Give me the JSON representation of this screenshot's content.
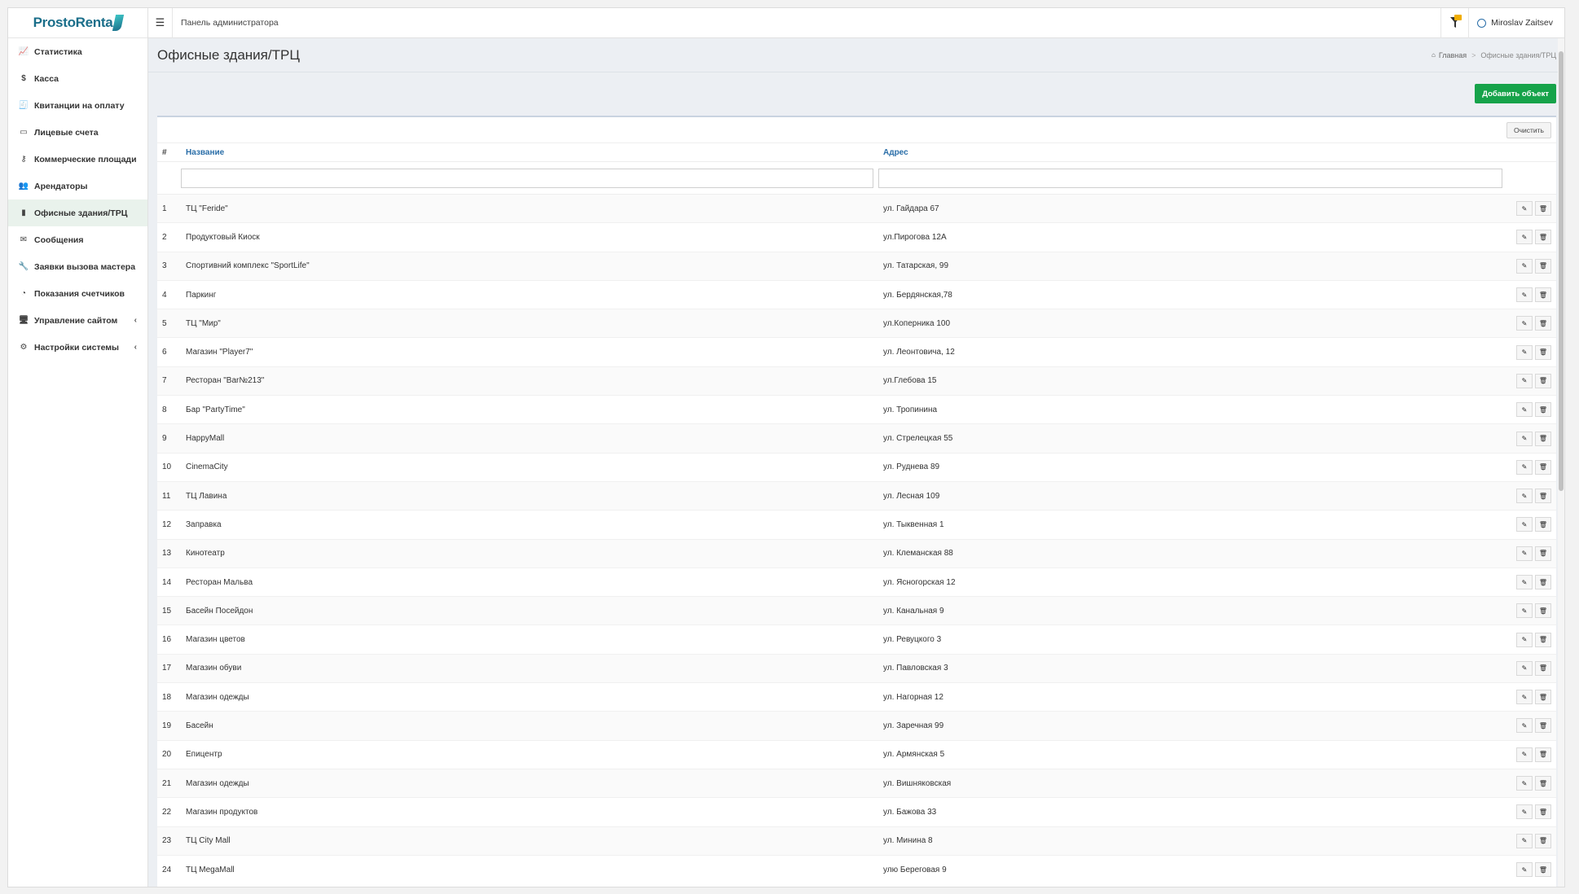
{
  "brand": {
    "name": "ProstoRenta"
  },
  "header": {
    "title": "Панель администратора",
    "user": "Miroslav Zaitsev"
  },
  "sidebar": {
    "items": [
      {
        "label": "Статистика",
        "icon": "chart-line-icon",
        "glyph": "📈",
        "active": false,
        "caret": false
      },
      {
        "label": "Касса",
        "icon": "dollar-icon",
        "glyph": "$",
        "active": false,
        "caret": false
      },
      {
        "label": "Квитанции на оплату",
        "icon": "receipt-icon",
        "glyph": "🧾",
        "active": false,
        "caret": false
      },
      {
        "label": "Лицевые счета",
        "icon": "credit-card-icon",
        "glyph": "▭",
        "active": false,
        "caret": false
      },
      {
        "label": "Коммерческие площади",
        "icon": "key-icon",
        "glyph": "⚷",
        "active": false,
        "caret": false
      },
      {
        "label": "Арендаторы",
        "icon": "users-icon",
        "glyph": "👥",
        "active": false,
        "caret": false
      },
      {
        "label": "Офисные здания/ТРЦ",
        "icon": "building-icon",
        "glyph": "▮",
        "active": true,
        "caret": false
      },
      {
        "label": "Сообщения",
        "icon": "envelope-icon",
        "glyph": "✉",
        "active": false,
        "caret": false
      },
      {
        "label": "Заявки вызова мастера",
        "icon": "wrench-icon",
        "glyph": "🔧",
        "active": false,
        "caret": false
      },
      {
        "label": "Показания счетчиков",
        "icon": "gauge-icon",
        "glyph": "◔",
        "active": false,
        "caret": false
      },
      {
        "label": "Управление сайтом",
        "icon": "desktop-icon",
        "glyph": "🖥",
        "active": false,
        "caret": true
      },
      {
        "label": "Настройки системы",
        "icon": "cogs-icon",
        "glyph": "⚙",
        "active": false,
        "caret": true
      }
    ]
  },
  "page": {
    "title": "Офисные здания/ТРЦ",
    "breadcrumb": {
      "home": "Главная",
      "separator": ">",
      "current": "Офисные здания/ТРЦ"
    },
    "add_button": "Добавить объект",
    "clear_button": "Очистить"
  },
  "table": {
    "columns": {
      "num": "#",
      "name": "Название",
      "address": "Адрес"
    },
    "rows": [
      {
        "num": "1",
        "name": "ТЦ \"Feride\"",
        "address": "ул. Гайдара 67"
      },
      {
        "num": "2",
        "name": "Продуктовый Киоск",
        "address": "ул.Пирогова 12А"
      },
      {
        "num": "3",
        "name": "Спортивний комплекс \"SportLife\"",
        "address": "ул. Татарская, 99"
      },
      {
        "num": "4",
        "name": "Паркинг",
        "address": "ул. Бердянская,78"
      },
      {
        "num": "5",
        "name": "ТЦ \"Мир\"",
        "address": "ул.Коперника 100"
      },
      {
        "num": "6",
        "name": "Магазин \"Player7\"",
        "address": "ул. Леонтовича, 12"
      },
      {
        "num": "7",
        "name": "Ресторан \"Bar№213\"",
        "address": "ул.Глебова 15"
      },
      {
        "num": "8",
        "name": "Бар \"PartyTime\"",
        "address": "ул. Тропинина"
      },
      {
        "num": "9",
        "name": "HappyMall",
        "address": "ул. Стрелецкая 55"
      },
      {
        "num": "10",
        "name": "CinemaCity",
        "address": "ул. Руднева 89"
      },
      {
        "num": "11",
        "name": "ТЦ Лавина",
        "address": "ул. Лесная 109"
      },
      {
        "num": "12",
        "name": "Заправка",
        "address": "ул. Тыквенная 1"
      },
      {
        "num": "13",
        "name": "Кинотеатр",
        "address": "ул. Клеманская 88"
      },
      {
        "num": "14",
        "name": "Ресторан Мальва",
        "address": "ул. Ясногорская 12"
      },
      {
        "num": "15",
        "name": "Басейн Посейдон",
        "address": "ул. Канальная 9"
      },
      {
        "num": "16",
        "name": "Магазин цветов",
        "address": "ул. Ревуцкого 3"
      },
      {
        "num": "17",
        "name": "Магазин обуви",
        "address": "ул. Павловская 3"
      },
      {
        "num": "18",
        "name": "Магазин одежды",
        "address": "ул. Нагорная 12"
      },
      {
        "num": "19",
        "name": "Басейн",
        "address": "ул. Заречная 99"
      },
      {
        "num": "20",
        "name": "Епицентр",
        "address": "ул. Армянская 5"
      },
      {
        "num": "21",
        "name": "Магазин одежды",
        "address": "ул. Вишняковская"
      },
      {
        "num": "22",
        "name": "Магазин продуктов",
        "address": "ул. Бажова 33"
      },
      {
        "num": "23",
        "name": "ТЦ City Mall",
        "address": "ул. Минина 8"
      },
      {
        "num": "24",
        "name": "ТЦ MegaMall",
        "address": "улю Береговая 9"
      }
    ]
  },
  "colors": {
    "accent": "#16a34a",
    "link": "#2a6ea8",
    "brand": "#1a6e8a"
  }
}
